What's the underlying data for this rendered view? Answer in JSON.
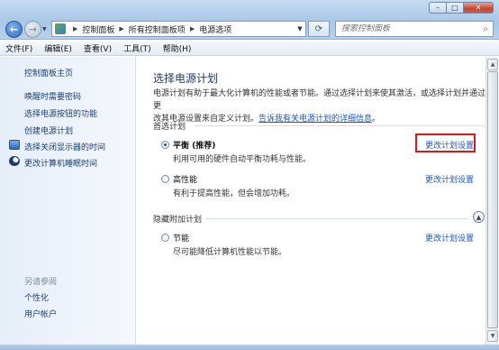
{
  "window": {
    "controls": {
      "minimize": "–",
      "maximize": "□",
      "close": "✕"
    }
  },
  "nav": {
    "back_icon": "←",
    "forward_icon": "→",
    "recent_icon": "▼"
  },
  "address": {
    "crumbs": [
      "控制面板",
      "所有控制面板项",
      "电源选项"
    ],
    "separator": "▶",
    "dropdown_icon": "▼",
    "refresh_icon": "⟳"
  },
  "search": {
    "placeholder": "搜索控制面板",
    "icon": "⌕"
  },
  "menu": [
    "文件(F)",
    "编辑(E)",
    "查看(V)",
    "工具(T)",
    "帮助(H)"
  ],
  "sidebar": {
    "home": "控制面板主页",
    "links": [
      "唤醒时需要密码",
      "选择电源按钮的功能",
      "创建电源计划",
      "选择关闭显示器的时间",
      "更改计算机睡眠时间"
    ],
    "see_also": "另请参阅",
    "see_also_links": [
      "个性化",
      "用户帐户"
    ]
  },
  "main": {
    "title": "选择电源计划",
    "desc_line1": "电源计划有助于最大化计算机的性能或者节能。通过选择计划来使其激活，或选择计划并通过更",
    "desc_line2": "改其电源设置来自定义计划。",
    "desc_link": "告诉我有关电源计划的详细信息",
    "desc_end": "。",
    "preferred_heading": "首选计划",
    "hidden_heading": "隐藏附加计划",
    "collapse_icon": "▲",
    "plans": [
      {
        "name": "平衡 (推荐)",
        "desc": "利用可用的硬件自动平衡功耗与性能。",
        "selected": true,
        "link": "更改计划设置"
      },
      {
        "name": "高性能",
        "desc": "有利于提高性能，但会增加功耗。",
        "selected": false,
        "link": "更改计划设置"
      },
      {
        "name": "节能",
        "desc": "尽可能降低计算机性能以节能。",
        "selected": false,
        "link": "更改计划设置"
      }
    ]
  },
  "scrollbar": {
    "up_icon": "▲",
    "down_icon": "▼"
  },
  "colors": {
    "link": "#1c56c4",
    "highlight": "#e0141a",
    "title": "#1f3a70"
  }
}
